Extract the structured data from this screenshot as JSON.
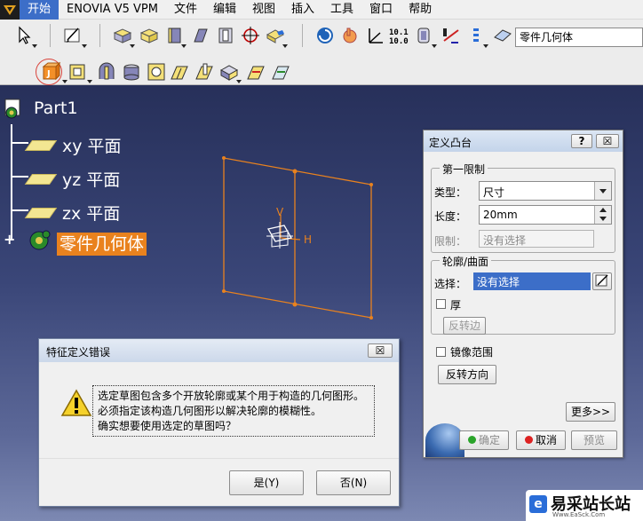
{
  "menubar": {
    "items": [
      "开始",
      "ENOVIA V5 VPM",
      "文件",
      "编辑",
      "视图",
      "插入",
      "工具",
      "窗口",
      "帮助"
    ]
  },
  "toolbar": {
    "current_body": "零件几何体",
    "num_icon_top": "10.1",
    "num_icon_bottom": "10.0"
  },
  "tree": {
    "root": "Part1",
    "items": [
      "xy 平面",
      "yz 平面",
      "zx 平面",
      "零件几何体"
    ]
  },
  "viewport": {
    "axis_v": "V",
    "axis_h": "H"
  },
  "pad_dialog": {
    "title": "定义凸台",
    "help": "?",
    "close": "☒",
    "first_limit": {
      "legend": "第一限制",
      "type_label": "类型：",
      "type_value": "尺寸",
      "length_label": "长度：",
      "length_value": "20mm",
      "limit_label": "限制：",
      "limit_value": "没有选择"
    },
    "profile": {
      "legend": "轮廓/曲面",
      "select_label": "选择：",
      "select_value": "没有选择",
      "thick_label": "厚",
      "reverse_side": "反转边"
    },
    "mirror_label": "镜像范围",
    "reverse_direction": "反转方向",
    "more": "更多>>",
    "ok": "确定",
    "cancel": "取消",
    "preview": "预览"
  },
  "error_dialog": {
    "title": "特征定义错误",
    "close": "☒",
    "message": [
      "选定草图包含多个开放轮廓或某个用于构造的几何图形。",
      "必须指定该构造几何图形以解决轮廓的模糊性。",
      "确实想要使用选定的草图吗？"
    ],
    "yes": "是(Y)",
    "no": "否(N)"
  },
  "watermark": {
    "text": "易采站长站",
    "sub": "Www.EaSck.Com"
  },
  "colors": {
    "selection_orange": "#e9821e",
    "highlight_blue": "#3c6ec8",
    "tree_connector": "#ffffff"
  }
}
